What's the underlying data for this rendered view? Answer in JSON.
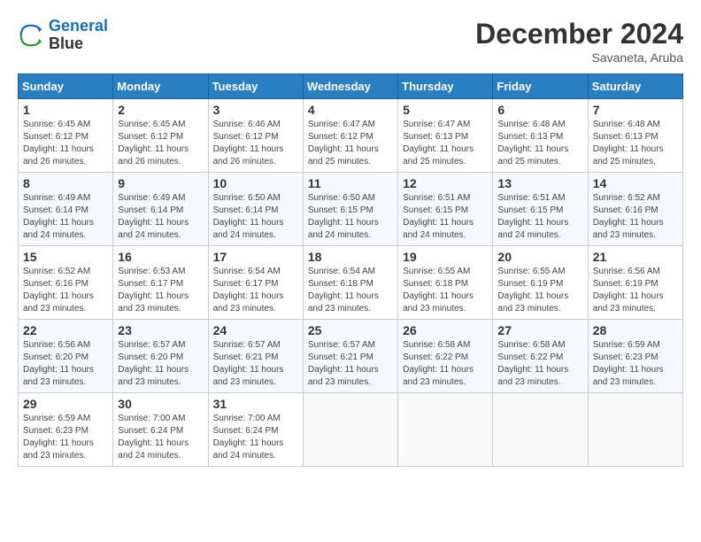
{
  "header": {
    "logo_line1": "General",
    "logo_line2": "Blue",
    "month": "December 2024",
    "location": "Savaneta, Aruba"
  },
  "weekdays": [
    "Sunday",
    "Monday",
    "Tuesday",
    "Wednesday",
    "Thursday",
    "Friday",
    "Saturday"
  ],
  "weeks": [
    [
      {
        "day": "1",
        "sunrise": "6:45 AM",
        "sunset": "6:12 PM",
        "daylight": "11 hours and 26 minutes."
      },
      {
        "day": "2",
        "sunrise": "6:45 AM",
        "sunset": "6:12 PM",
        "daylight": "11 hours and 26 minutes."
      },
      {
        "day": "3",
        "sunrise": "6:46 AM",
        "sunset": "6:12 PM",
        "daylight": "11 hours and 26 minutes."
      },
      {
        "day": "4",
        "sunrise": "6:47 AM",
        "sunset": "6:12 PM",
        "daylight": "11 hours and 25 minutes."
      },
      {
        "day": "5",
        "sunrise": "6:47 AM",
        "sunset": "6:13 PM",
        "daylight": "11 hours and 25 minutes."
      },
      {
        "day": "6",
        "sunrise": "6:48 AM",
        "sunset": "6:13 PM",
        "daylight": "11 hours and 25 minutes."
      },
      {
        "day": "7",
        "sunrise": "6:48 AM",
        "sunset": "6:13 PM",
        "daylight": "11 hours and 25 minutes."
      }
    ],
    [
      {
        "day": "8",
        "sunrise": "6:49 AM",
        "sunset": "6:14 PM",
        "daylight": "11 hours and 24 minutes."
      },
      {
        "day": "9",
        "sunrise": "6:49 AM",
        "sunset": "6:14 PM",
        "daylight": "11 hours and 24 minutes."
      },
      {
        "day": "10",
        "sunrise": "6:50 AM",
        "sunset": "6:14 PM",
        "daylight": "11 hours and 24 minutes."
      },
      {
        "day": "11",
        "sunrise": "6:50 AM",
        "sunset": "6:15 PM",
        "daylight": "11 hours and 24 minutes."
      },
      {
        "day": "12",
        "sunrise": "6:51 AM",
        "sunset": "6:15 PM",
        "daylight": "11 hours and 24 minutes."
      },
      {
        "day": "13",
        "sunrise": "6:51 AM",
        "sunset": "6:15 PM",
        "daylight": "11 hours and 24 minutes."
      },
      {
        "day": "14",
        "sunrise": "6:52 AM",
        "sunset": "6:16 PM",
        "daylight": "11 hours and 23 minutes."
      }
    ],
    [
      {
        "day": "15",
        "sunrise": "6:52 AM",
        "sunset": "6:16 PM",
        "daylight": "11 hours and 23 minutes."
      },
      {
        "day": "16",
        "sunrise": "6:53 AM",
        "sunset": "6:17 PM",
        "daylight": "11 hours and 23 minutes."
      },
      {
        "day": "17",
        "sunrise": "6:54 AM",
        "sunset": "6:17 PM",
        "daylight": "11 hours and 23 minutes."
      },
      {
        "day": "18",
        "sunrise": "6:54 AM",
        "sunset": "6:18 PM",
        "daylight": "11 hours and 23 minutes."
      },
      {
        "day": "19",
        "sunrise": "6:55 AM",
        "sunset": "6:18 PM",
        "daylight": "11 hours and 23 minutes."
      },
      {
        "day": "20",
        "sunrise": "6:55 AM",
        "sunset": "6:19 PM",
        "daylight": "11 hours and 23 minutes."
      },
      {
        "day": "21",
        "sunrise": "6:56 AM",
        "sunset": "6:19 PM",
        "daylight": "11 hours and 23 minutes."
      }
    ],
    [
      {
        "day": "22",
        "sunrise": "6:56 AM",
        "sunset": "6:20 PM",
        "daylight": "11 hours and 23 minutes."
      },
      {
        "day": "23",
        "sunrise": "6:57 AM",
        "sunset": "6:20 PM",
        "daylight": "11 hours and 23 minutes."
      },
      {
        "day": "24",
        "sunrise": "6:57 AM",
        "sunset": "6:21 PM",
        "daylight": "11 hours and 23 minutes."
      },
      {
        "day": "25",
        "sunrise": "6:57 AM",
        "sunset": "6:21 PM",
        "daylight": "11 hours and 23 minutes."
      },
      {
        "day": "26",
        "sunrise": "6:58 AM",
        "sunset": "6:22 PM",
        "daylight": "11 hours and 23 minutes."
      },
      {
        "day": "27",
        "sunrise": "6:58 AM",
        "sunset": "6:22 PM",
        "daylight": "11 hours and 23 minutes."
      },
      {
        "day": "28",
        "sunrise": "6:59 AM",
        "sunset": "6:23 PM",
        "daylight": "11 hours and 23 minutes."
      }
    ],
    [
      {
        "day": "29",
        "sunrise": "6:59 AM",
        "sunset": "6:23 PM",
        "daylight": "11 hours and 23 minutes."
      },
      {
        "day": "30",
        "sunrise": "7:00 AM",
        "sunset": "6:24 PM",
        "daylight": "11 hours and 24 minutes."
      },
      {
        "day": "31",
        "sunrise": "7:00 AM",
        "sunset": "6:24 PM",
        "daylight": "11 hours and 24 minutes."
      },
      null,
      null,
      null,
      null
    ]
  ]
}
